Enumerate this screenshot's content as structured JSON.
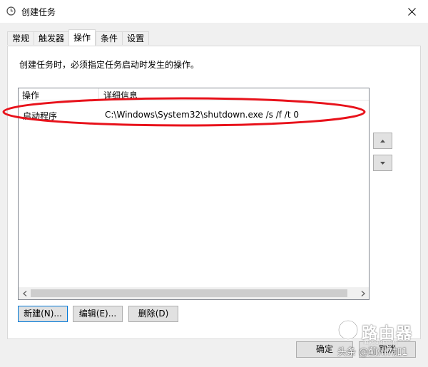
{
  "window": {
    "title": "创建任务",
    "close_glyph": "×"
  },
  "tabs": [
    {
      "label": "常规",
      "active": false
    },
    {
      "label": "触发器",
      "active": false
    },
    {
      "label": "操作",
      "active": true
    },
    {
      "label": "条件",
      "active": false
    },
    {
      "label": "设置",
      "active": false
    }
  ],
  "actions_tab": {
    "description": "创建任务时，必须指定任务启动时发生的操作。",
    "list": {
      "columns": [
        "操作",
        "详细信息"
      ],
      "rows": [
        {
          "action": "启动程序",
          "details": "C:\\Windows\\System32\\shutdown.exe /s /f /t 0"
        }
      ]
    },
    "buttons": {
      "new": "新建(N)...",
      "edit": "编辑(E)...",
      "delete": "删除(D)"
    },
    "move_up_icon": "triangle-up",
    "move_down_icon": "triangle-down"
  },
  "dialog_buttons": {
    "ok": "确定",
    "cancel": "取消"
  },
  "annotation": {
    "color": "#e8121b"
  },
  "watermark": {
    "brand": "路由器",
    "site": "luyouqi.com",
    "credit": "头条 @蓟州7加1"
  }
}
